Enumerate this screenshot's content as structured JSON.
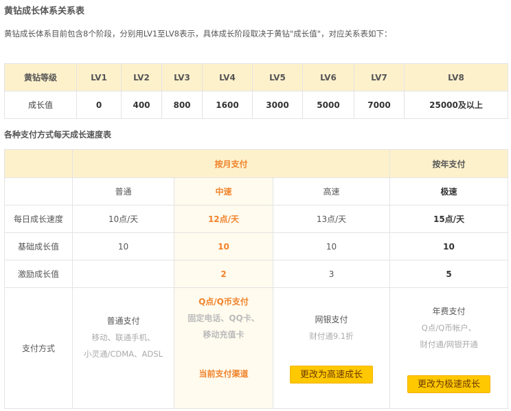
{
  "page": {
    "title": "黄钻成长体系关系表",
    "intro": "黄钻成长体系目前包含8个阶段，分别用LV1至LV8表示，具体成长阶段取决于黄钻\"成长值\"，对应关系表如下：",
    "speed_title": "各种支付方式每天成长速度表"
  },
  "levels_table": {
    "header_label": "黄钻等级",
    "value_label": "成长值",
    "levels": [
      "LV1",
      "LV2",
      "LV3",
      "LV4",
      "LV5",
      "LV6",
      "LV7",
      "LV8"
    ],
    "values": [
      "0",
      "400",
      "800",
      "1600",
      "3000",
      "5000",
      "7000",
      "25000及以上"
    ]
  },
  "speed_table": {
    "monthly_header": "按月支付",
    "yearly_header": "按年支付",
    "speeds": [
      "普通",
      "中速",
      "高速",
      "极速"
    ],
    "rows": {
      "daily": {
        "label": "每日成长速度",
        "cells": [
          "10点/天",
          "12点/天",
          "13点/天",
          "15点/天"
        ]
      },
      "base": {
        "label": "基础成长值",
        "cells": [
          "10",
          "10",
          "10",
          "10"
        ]
      },
      "bonus": {
        "label": "激励成长值",
        "cells": [
          "",
          "2",
          "3",
          "5"
        ]
      }
    },
    "payment": {
      "label": "支付方式",
      "normal": {
        "title": "普通支付",
        "line1": "移动、联通手机、",
        "line2": "小灵通/CDMA、ADSL"
      },
      "medium": {
        "line1": "Q点/Q币支付",
        "line2": "固定电话、QQ卡、",
        "line3": "移动充值卡",
        "current": "当前支付渠道"
      },
      "fast": {
        "title": "网银支付",
        "sub": "财付通9.1折",
        "button": "更改为高速成长"
      },
      "ultra": {
        "title": "年费支付",
        "line1": "Q点/Q币帐户、",
        "line2": "财付通/网银开通",
        "button": "更改为极速成长"
      }
    }
  }
}
